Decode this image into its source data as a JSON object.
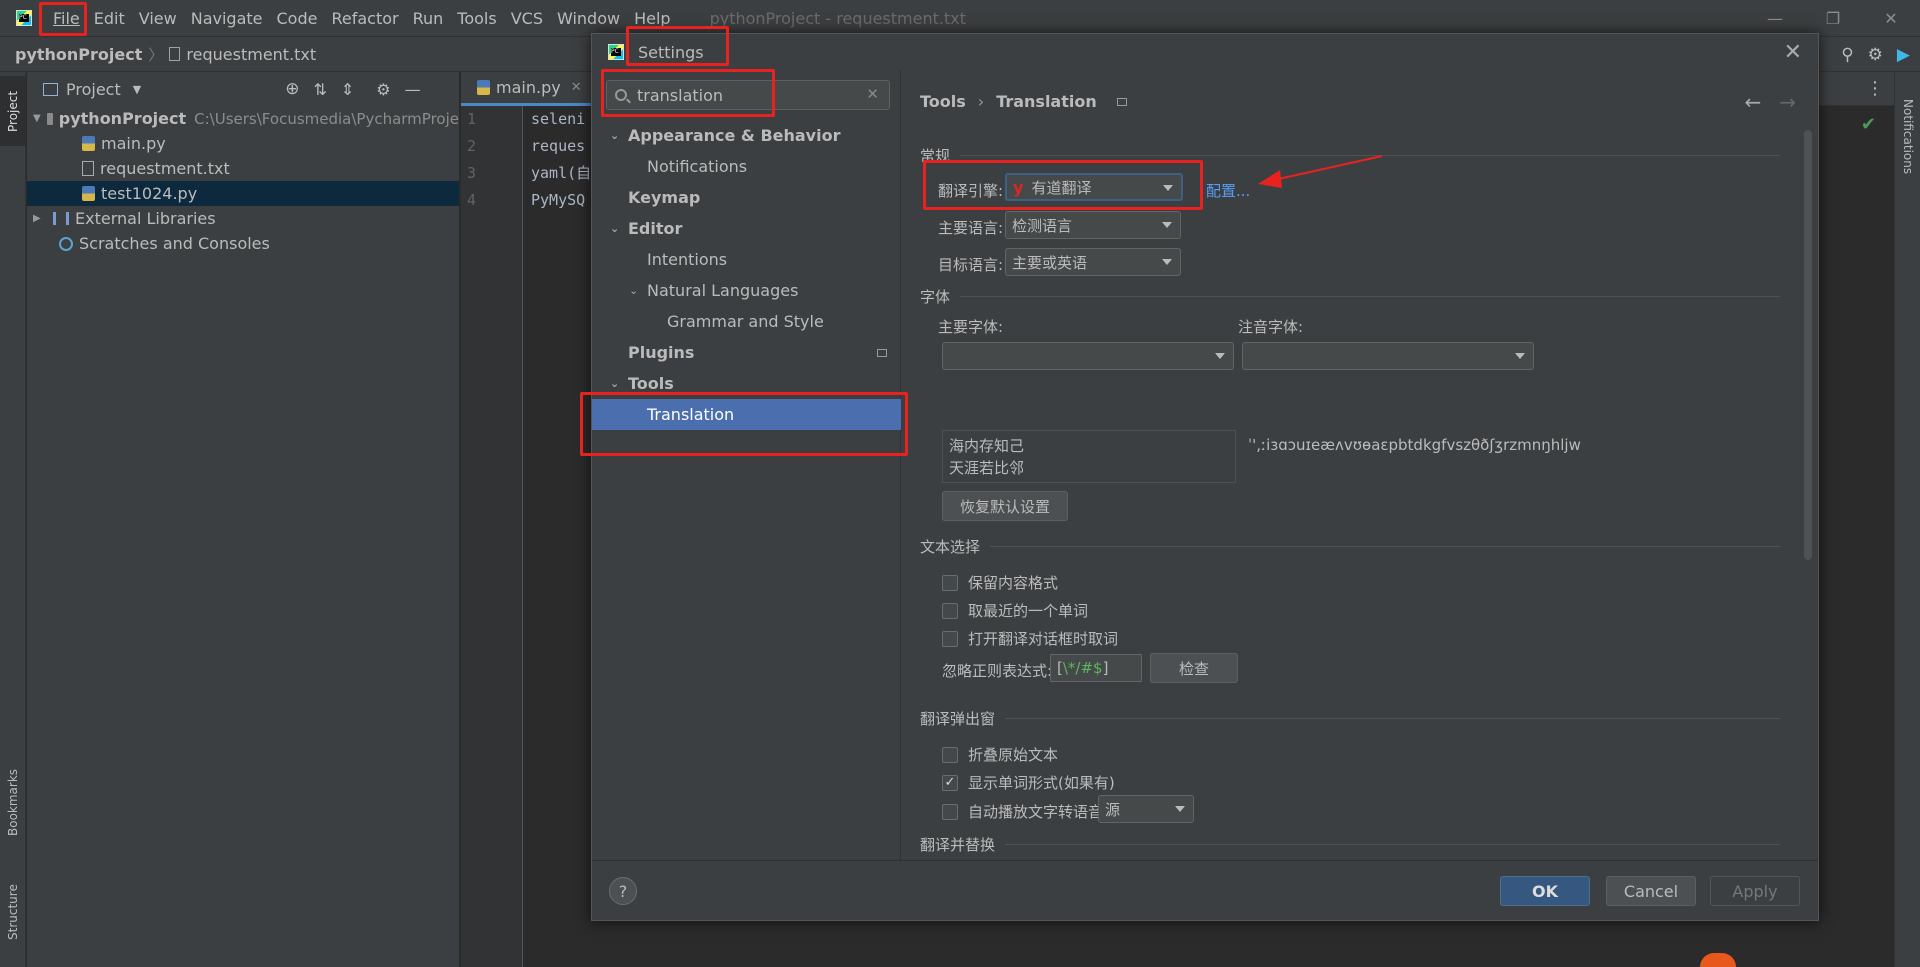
{
  "menubar": {
    "items": [
      "File",
      "Edit",
      "View",
      "Navigate",
      "Code",
      "Refactor",
      "Run",
      "Tools",
      "VCS",
      "Window",
      "Help"
    ],
    "window_title": "pythonProject - requestment.txt"
  },
  "navbar": {
    "project": "pythonProject",
    "file": "requestment.txt"
  },
  "left_strip": {
    "project_tab": "Project",
    "bookmarks_tab": "Bookmarks",
    "structure_tab": "Structure"
  },
  "right_strip": {
    "notifications_tab": "Notifications"
  },
  "project_panel": {
    "title": "Project",
    "root": "pythonProject",
    "root_path": "C:\\Users\\Focusmedia\\PycharmProje",
    "files": [
      "main.py",
      "requestment.txt",
      "test1024.py"
    ],
    "external_libraries": "External Libraries",
    "scratches": "Scratches and Consoles"
  },
  "editor": {
    "tab": "main.py",
    "line_numbers": [
      "1",
      "2",
      "3",
      "4"
    ],
    "lines": [
      "seleni",
      "reques",
      "yaml(自",
      "PyMySQ"
    ]
  },
  "settings": {
    "title": "Settings",
    "search_value": "translation",
    "tree": {
      "appearance": "Appearance & Behavior",
      "notifications": "Notifications",
      "keymap": "Keymap",
      "editor": "Editor",
      "intentions": "Intentions",
      "natural_languages": "Natural Languages",
      "grammar": "Grammar and Style",
      "plugins": "Plugins",
      "tools": "Tools",
      "translation": "Translation"
    },
    "breadcrumb": {
      "parent": "Tools",
      "sep": "›",
      "current": "Translation"
    },
    "general": {
      "header": "常规",
      "engine_label": "翻译引擎:",
      "engine_value": "有道翻译",
      "engine_icon": "youdao-y-icon",
      "configure_link": "配置...",
      "primary_lang_label": "主要语言:",
      "primary_lang_value": "检测语言",
      "target_lang_label": "目标语言:",
      "target_lang_value": "主要或英语"
    },
    "fonts": {
      "header": "字体",
      "primary_font_label": "主要字体:",
      "phonetic_font_label": "注音字体:",
      "preview_line1": "海内存知己",
      "preview_line2": "天涯若比邻",
      "phonetic_preview": "ˈ',ːiɜɑɔuɪeæʌvʊɵaɛpbtdkgfvszθðʃʒrzmnŋhljw",
      "reset_button": "恢复默认设置"
    },
    "text_selection": {
      "header": "文本选择",
      "keep_format": "保留内容格式",
      "take_nearest": "取最近的一个单词",
      "take_on_open": "打开翻译对话框时取词",
      "ignore_regex_label": "忽略正则表达式:",
      "ignore_regex_bracket": "[",
      "ignore_regex_value": "\\*/#$",
      "ignore_regex_close": "]",
      "check_button": "检查"
    },
    "popup": {
      "header": "翻译弹出窗",
      "fold_original": "折叠原始文本",
      "show_word_forms": "显示单词形式(如果有)",
      "show_word_forms_checked": true,
      "auto_tts": "自动播放文字转语音:",
      "auto_tts_value": "源"
    },
    "translate_replace": {
      "header": "翻译并替换"
    },
    "footer": {
      "help": "?",
      "ok": "OK",
      "cancel": "Cancel",
      "apply": "Apply"
    }
  },
  "colors": {
    "highlight": "#e8231f",
    "accent": "#4b6eaf",
    "link": "#589df6"
  }
}
